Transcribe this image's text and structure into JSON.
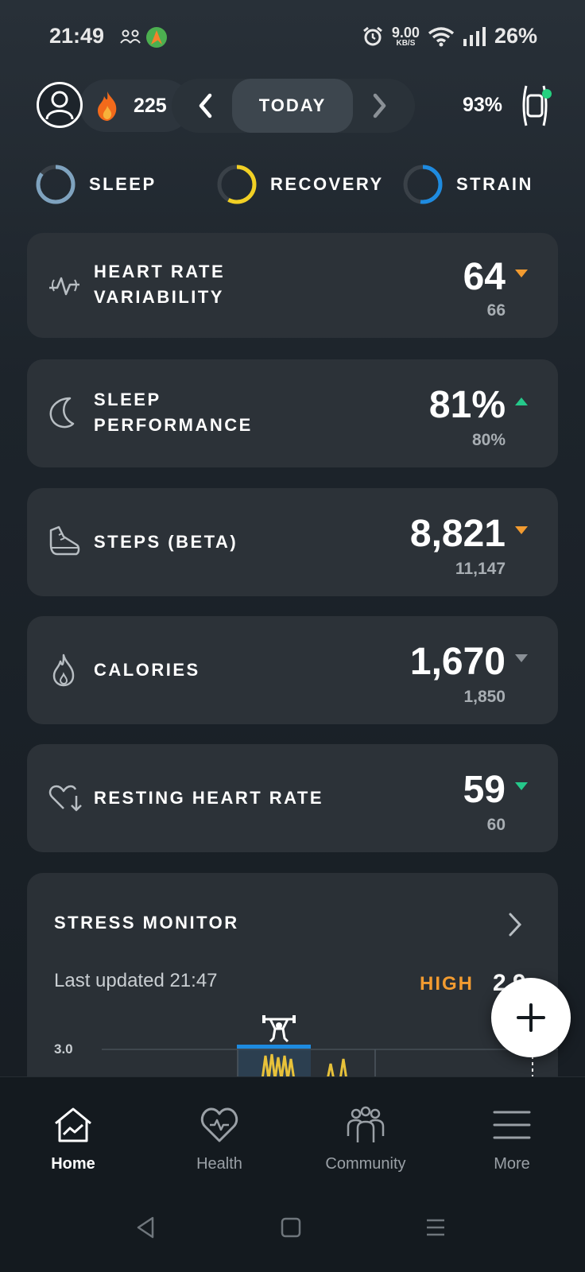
{
  "status_bar": {
    "time": "21:49",
    "net_speed_value": "9.00",
    "net_speed_unit": "KB/S",
    "battery": "26%"
  },
  "top_bar": {
    "streak": "225",
    "date_label": "TODAY",
    "band_battery": "93%"
  },
  "tabs": [
    {
      "label": "SLEEP",
      "color": "#7fa3bf"
    },
    {
      "label": "RECOVERY",
      "color": "#f2d024"
    },
    {
      "label": "STRAIN",
      "color": "#1e8be0"
    }
  ],
  "metrics": [
    {
      "label_line1": "HEART RATE",
      "label_line2": "VARIABILITY",
      "value": "64",
      "baseline": "66",
      "trend": "down",
      "trend_color": "#f29b30",
      "icon": "hrv-pulse-icon"
    },
    {
      "label_line1": "SLEEP",
      "label_line2": "PERFORMANCE",
      "value": "81%",
      "baseline": "80%",
      "trend": "up",
      "trend_color": "#25c88a",
      "icon": "moon-icon"
    },
    {
      "label_line1": "STEPS (BETA)",
      "value": "8,821",
      "baseline": "11,147",
      "trend": "down",
      "trend_color": "#f29b30",
      "icon": "shoe-icon"
    },
    {
      "label_line1": "CALORIES",
      "value": "1,670",
      "baseline": "1,850",
      "trend": "down",
      "trend_color": "#8a9096",
      "icon": "flame-icon"
    },
    {
      "label_line1": "RESTING HEART RATE",
      "value": "59",
      "baseline": "60",
      "trend": "down",
      "trend_color": "#25c88a",
      "icon": "heart-down-icon"
    }
  ],
  "stress": {
    "title": "STRESS MONITOR",
    "last_updated": "Last updated 21:47",
    "level": "HIGH",
    "value": "2.9",
    "axis_top": "3.0",
    "activity_icon": "weightlifting-icon"
  },
  "nav": [
    {
      "label": "Home",
      "icon": "home-chart-icon",
      "active": true
    },
    {
      "label": "Health",
      "icon": "heart-pulse-icon",
      "active": false
    },
    {
      "label": "Community",
      "icon": "people-icon",
      "active": false
    },
    {
      "label": "More",
      "icon": "menu-icon",
      "active": false
    }
  ]
}
